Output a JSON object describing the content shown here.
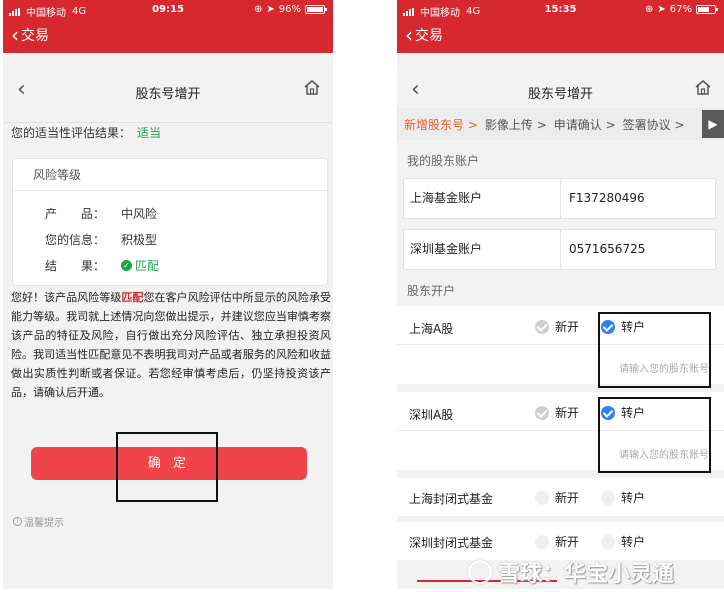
{
  "left": {
    "status": {
      "carrier": "中国移动",
      "network": "4G",
      "time": "09:15",
      "battery": "96%",
      "battery_level": 0.96
    },
    "header": {
      "back_label": "交易"
    },
    "nav": {
      "title": "股东号增开"
    },
    "result": {
      "label": "您的适当性评估结果：",
      "value": "适当"
    },
    "risk_card": {
      "title": "风险等级",
      "rows": [
        {
          "key": "产　　品：",
          "value": "中风险"
        },
        {
          "key": "您的信息：",
          "value": "积极型"
        },
        {
          "key": "结　　果：",
          "value": "匹配"
        }
      ]
    },
    "notice": {
      "part1": "您好！该产品风险等级",
      "highlight": "匹配",
      "part2": "您在客户风险评估中所显示的风险承受能力等级。我司就上述情况向您做出提示，并建议您应当审慎考察该产品的特征及风险，自行做出充分风险评估、独立承担投资风险。我司适当性匹配意见不表明我司对产品或者服务的风险和收益做出实质性判断或者保证。若您经审慎考虑后，仍坚持投资该产品，请确认后开通。"
    },
    "confirm_label": "确 定",
    "tip_label": "温馨提示"
  },
  "right": {
    "status": {
      "carrier": "中国移动",
      "network": "4G",
      "time": "15:35",
      "battery": "67%",
      "battery_level": 0.67
    },
    "header": {
      "back_label": "交易"
    },
    "nav": {
      "title": "股东号增开"
    },
    "steps": [
      {
        "label": "新增股东号 >"
      },
      {
        "label": "影像上传 >"
      },
      {
        "label": "申请确认 >"
      },
      {
        "label": "签署协议 >"
      }
    ],
    "my_accounts_label": "我的股东账户",
    "accounts": [
      {
        "name": "上海基金账户",
        "number": "F137280496"
      },
      {
        "name": "深圳基金账户",
        "number": "0571656725"
      }
    ],
    "open_label": "股东开户",
    "open_rows": [
      {
        "name": "上海A股",
        "opt_new": "新开",
        "opt_transfer": "转户",
        "placeholder": "请输入您的股东账号"
      },
      {
        "name": "深圳A股",
        "opt_new": "新开",
        "opt_transfer": "转户",
        "placeholder": "请输入您的股东账号"
      },
      {
        "name": "上海封闭式基金",
        "opt_new": "新开",
        "opt_transfer": "转户"
      },
      {
        "name": "深圳封闭式基金",
        "opt_new": "新开",
        "opt_transfer": "转户"
      }
    ]
  },
  "watermark": "雪球：华宝小灵通"
}
